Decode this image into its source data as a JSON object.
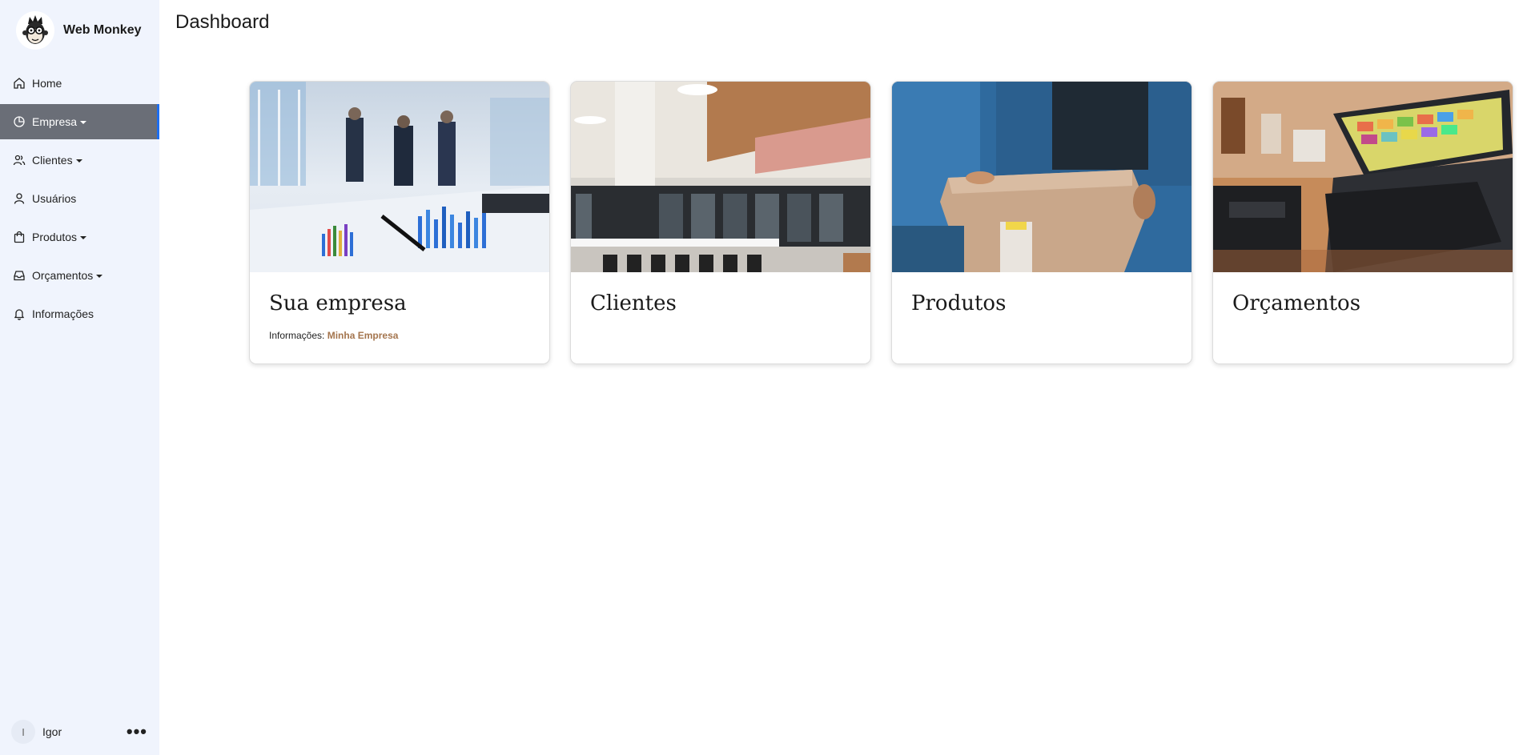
{
  "brand": {
    "name": "Web Monkey",
    "logo_icon": "monkey-glasses-icon"
  },
  "sidebar": {
    "items": [
      {
        "label": "Home",
        "icon": "home-icon",
        "dropdown": false,
        "active": false
      },
      {
        "label": "Empresa",
        "icon": "pie-chart-icon",
        "dropdown": true,
        "active": true
      },
      {
        "label": "Clientes",
        "icon": "users-icon",
        "dropdown": true,
        "active": false
      },
      {
        "label": "Usuários",
        "icon": "user-icon",
        "dropdown": false,
        "active": false
      },
      {
        "label": "Produtos",
        "icon": "shopping-bag-icon",
        "dropdown": true,
        "active": false
      },
      {
        "label": "Orçamentos",
        "icon": "inbox-icon",
        "dropdown": true,
        "active": false
      },
      {
        "label": "Informações",
        "icon": "bell-icon",
        "dropdown": false,
        "active": false
      }
    ]
  },
  "user": {
    "initial": "I",
    "name": "Igor",
    "more_label": "•••"
  },
  "page": {
    "title": "Dashboard"
  },
  "cards": [
    {
      "title": "Sua empresa",
      "image": "business-meeting-photo",
      "info_label": "Informações:",
      "info_value": "Minha Empresa"
    },
    {
      "title": "Clientes",
      "image": "office-interior-photo"
    },
    {
      "title": "Produtos",
      "image": "package-delivery-photo"
    },
    {
      "title": "Orçamentos",
      "image": "pos-terminal-photo"
    }
  ],
  "colors": {
    "sidebar_bg": "#f0f4fd",
    "active_bg": "#6a6e77",
    "active_accent": "#1e6ef0",
    "link": "#a4754e"
  }
}
